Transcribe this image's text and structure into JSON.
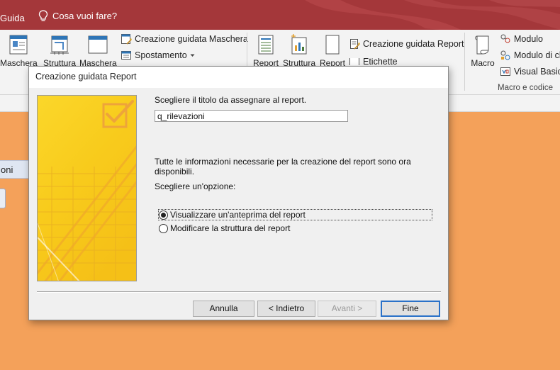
{
  "app": {
    "menu_help": "Guida",
    "tell_me": "Cosa vuoi fare?",
    "colors": {
      "titlebar": "#a4373a",
      "workspace": "#f4a15a",
      "ribbon": "#f3f3f3",
      "default_button_border": "#2a71c8"
    }
  },
  "ribbon": {
    "mask_button": "Maschera",
    "split_button": "Struttura",
    "blank_mask_button": "Maschera",
    "mask_wizard": "Creazione guidata Maschera",
    "navigation": "Spostamento",
    "report_button": "Report",
    "report_design_button": "Struttura",
    "blank_report_button": "Report",
    "report_wizard": "Creazione guidata Report",
    "labels_button": "Etichette",
    "macro_button": "Macro",
    "module": "Modulo",
    "class_module": "Modulo di cl",
    "visual_basic": "Visual Basic",
    "group_macro": "Macro e codice"
  },
  "left_tab": {
    "label": "oni"
  },
  "dialog": {
    "title": "Creazione guidata Report",
    "prompt_title": "Scegliere il titolo da assegnare al report.",
    "report_title_value": "q_rilevazioni",
    "info_line1": "Tutte le informazioni necessarie per la creazione del report sono ora",
    "info_line2": "disponibili.",
    "choose_option": "Scegliere un'opzione:",
    "option_preview": "Visualizzare un'anteprima del report",
    "option_modify": "Modificare la struttura del report",
    "buttons": {
      "cancel": "Annulla",
      "back": "< Indietro",
      "next": "Avanti >",
      "finish": "Fine"
    }
  }
}
